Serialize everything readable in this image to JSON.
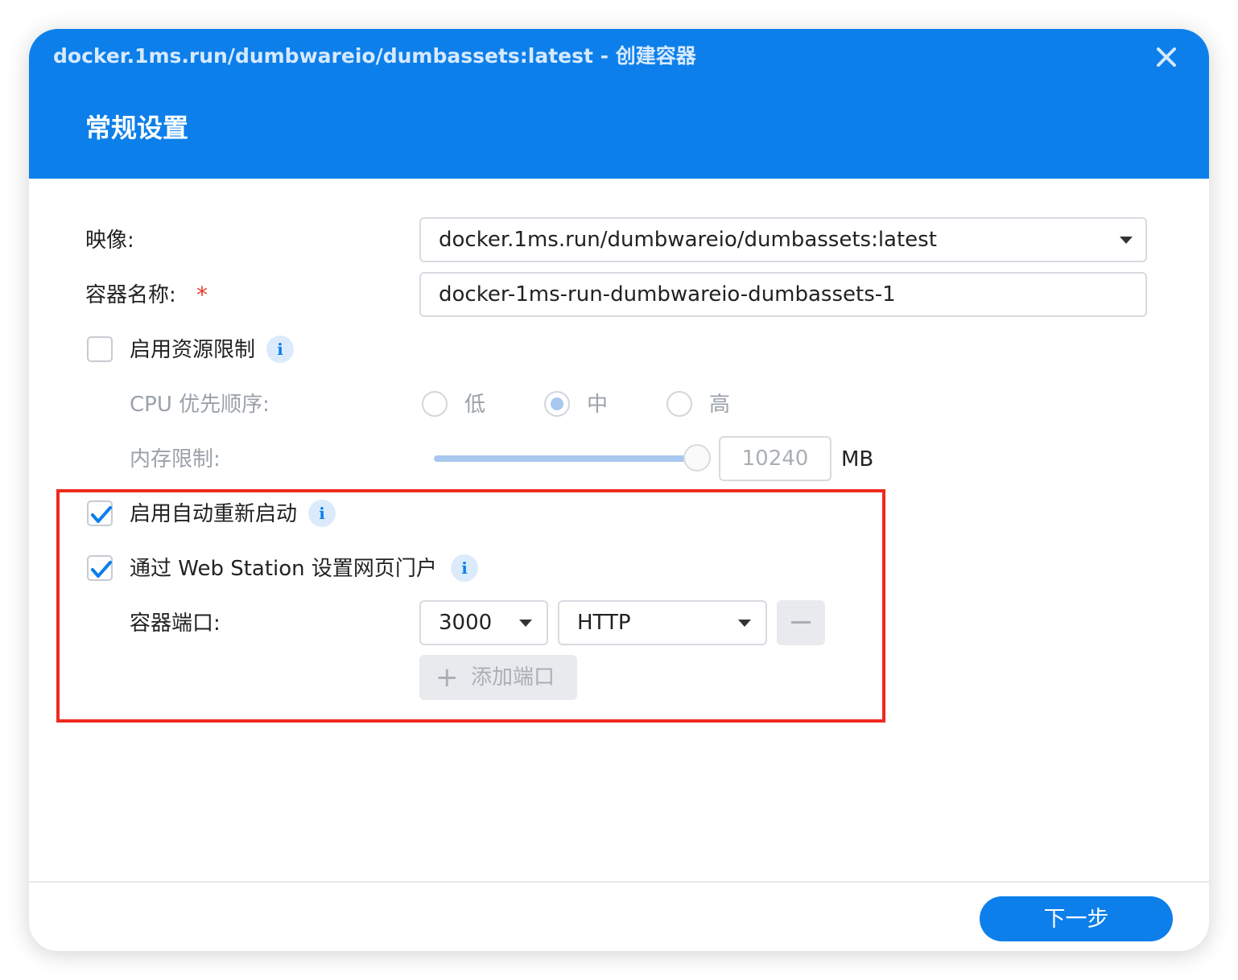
{
  "window": {
    "title": "docker.1ms.run/dumbwareio/dumbassets:latest - 创建容器",
    "close_icon": "close-icon"
  },
  "section": {
    "title": "常规设置"
  },
  "form": {
    "image": {
      "label": "映像:",
      "value": "docker.1ms.run/dumbwareio/dumbassets:latest"
    },
    "container_name": {
      "label": "容器名称:",
      "required_mark": "*",
      "value": "docker-1ms-run-dumbwareio-dumbassets-1"
    },
    "resource_limit": {
      "label": "启用资源限制",
      "checked": false,
      "info": "i"
    },
    "cpu_priority": {
      "label": "CPU 优先顺序:",
      "options": [
        {
          "label": "低",
          "selected": false
        },
        {
          "label": "中",
          "selected": true
        },
        {
          "label": "高",
          "selected": false
        }
      ]
    },
    "memory_limit": {
      "label": "内存限制:",
      "value": "10240",
      "unit": "MB",
      "slider_fraction": 0.95
    },
    "auto_restart": {
      "label": "启用自动重新启动",
      "checked": true,
      "info": "i"
    },
    "web_station": {
      "label": "通过 Web Station 设置网页门户",
      "checked": true,
      "info": "i"
    },
    "container_port": {
      "label": "容器端口:",
      "port": "3000",
      "protocol": "HTTP"
    },
    "add_port": {
      "label": "添加端口",
      "icon": "plus-icon"
    }
  },
  "footer": {
    "next_label": "下一步"
  },
  "colors": {
    "accent": "#0c7fea",
    "highlight": "#ee2a1f",
    "required": "#e23b2e"
  }
}
